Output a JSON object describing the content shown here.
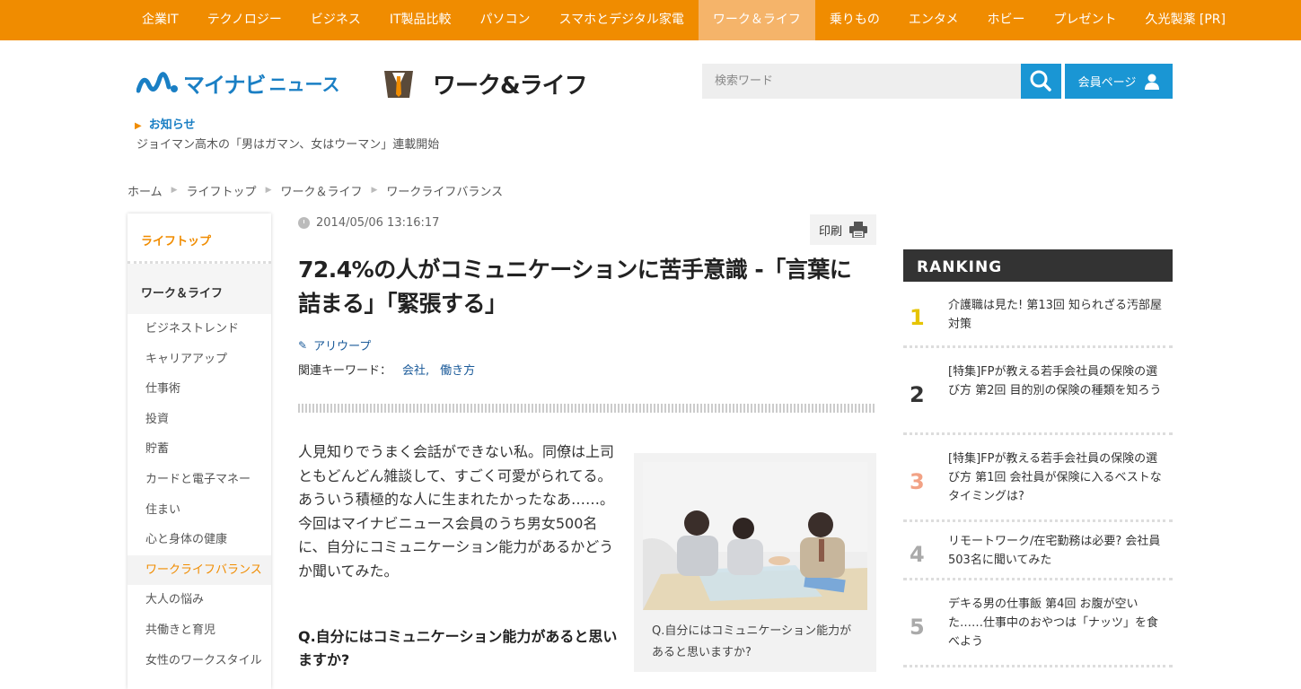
{
  "nav": {
    "items": [
      "企業IT",
      "テクノロジー",
      "ビジネス",
      "IT製品比較",
      "パソコン",
      "スマホとデジタル家電",
      "ワーク＆ライフ",
      "乗りもの",
      "エンタメ",
      "ホビー",
      "プレゼント",
      "久光製薬 [PR]"
    ],
    "active": "ワーク＆ライフ",
    "accent": "#f08c00"
  },
  "header": {
    "logo_main": "マイナビ",
    "logo_sub": "ニュース",
    "section_logo": "ワーク&ライフ",
    "search_placeholder": "検索ワード",
    "member_label": "会員ページ"
  },
  "notice": {
    "label": "お知らせ",
    "text": "ジョイマン高木の「男はガマン、女はウーマン」連載開始"
  },
  "breadcrumb": [
    "ホーム",
    "ライフトップ",
    "ワーク＆ライフ",
    "ワークライフバランス"
  ],
  "sidebar": {
    "top": "ライフトップ",
    "category": "ワーク＆ライフ",
    "items": [
      "ビジネストレンド",
      "キャリアアップ",
      "仕事術",
      "投資",
      "貯蓄",
      "カードと電子マネー",
      "住まい",
      "心と身体の健康",
      "ワークライフバランス",
      "大人の悩み",
      "共働きと育児",
      "女性のワークスタイル"
    ],
    "active": "ワークライフバランス"
  },
  "article": {
    "date": "2014/05/06 13:16:17",
    "print_label": "印刷",
    "title": "72.4%の人がコミュニケーションに苦手意識 -「言葉に詰まる」「緊張する」",
    "author": "アリウープ",
    "keywords_label": "関連キーワード：",
    "keywords": [
      "会社,",
      "働き方"
    ],
    "body": "人見知りでうまく会話ができない私。同僚は上司ともどんどん雑談して、すごく可愛がられてる。あういう積極的な人に生まれたかったなあ……。今回はマイナビニュース会員のうち男女500名に、自分にコミュニケーション能力があるかどうか聞いてみた。",
    "question": "Q.自分にはコミュニケーション能力があると思いますか?",
    "figure_caption": "Q.自分にはコミュニケーション能力があると思いますか?"
  },
  "ranking": {
    "heading": "RANKING",
    "items": [
      {
        "rank": "1",
        "text": "介護職は見た! 第13回 知られざる汚部屋対策",
        "color": "#e6c400"
      },
      {
        "rank": "2",
        "text": "[特集]FPが教える若手会社員の保険の選び方 第2回 目的別の保険の種類を知ろう",
        "color": "#333333"
      },
      {
        "rank": "3",
        "text": "[特集]FPが教える若手会社員の保険の選び方 第1回 会社員が保険に入るベストなタイミングは?",
        "color": "#f2a285"
      },
      {
        "rank": "4",
        "text": "リモートワーク/在宅勤務は必要? 会社員503名に聞いてみた",
        "color": "#aaaaaa"
      },
      {
        "rank": "5",
        "text": "デキる男の仕事飯 第4回 お腹が空いた……仕事中のおやつは「ナッツ」を食べよう",
        "color": "#aaaaaa"
      }
    ]
  }
}
